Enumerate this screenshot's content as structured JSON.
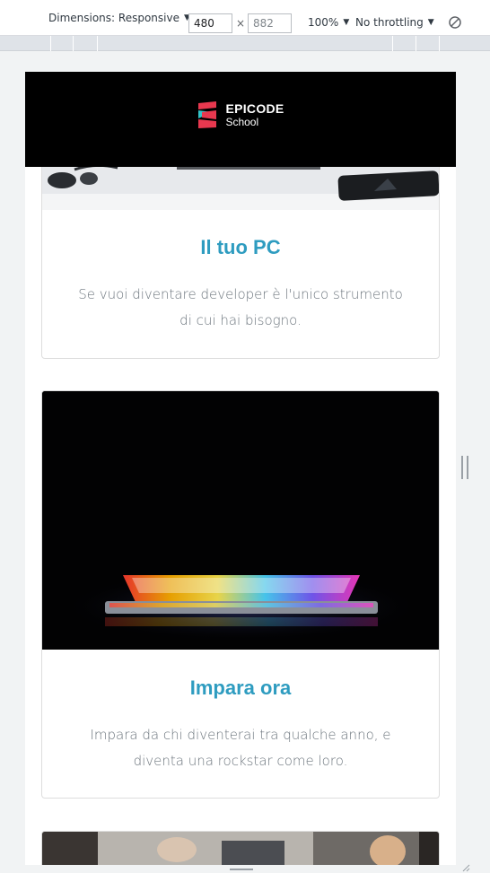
{
  "devtools": {
    "dimensions_label": "Dimensions: Responsive",
    "width_value": "480",
    "height_value": "882",
    "times": "×",
    "zoom": "100%",
    "throttling": "No throttling",
    "caret": "▼",
    "icons": [
      "chevron-down-icon",
      "rotate-icon"
    ]
  },
  "site": {
    "logo_title": "EPICODE",
    "logo_sub": "School",
    "colors": {
      "header_bg": "#000000",
      "accent": "#2e9cc0",
      "logo_red": "#e8384f",
      "logo_teal": "#34c3c8"
    }
  },
  "cards": [
    {
      "title": "Il tuo PC",
      "text_line1": "Se vuoi diventare developer è l'unico strumento",
      "text_line2": "di cui hai bisogno."
    },
    {
      "title": "Impara ora",
      "text_line1": "Impara da chi diventerai tra qualche anno, e",
      "text_line2": "diventa una rockstar come loro."
    }
  ]
}
